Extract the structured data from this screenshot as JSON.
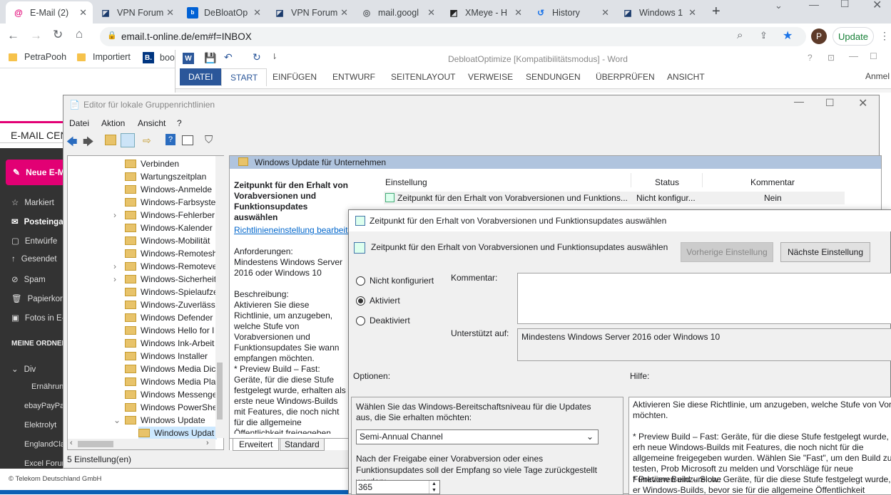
{
  "browser": {
    "tabs": [
      {
        "title": "E-Mail (2)",
        "icon": "email-icon"
      },
      {
        "title": "VPN Forum",
        "icon": "vpn-icon"
      },
      {
        "title": "DeBloatOp",
        "icon": "box-icon"
      },
      {
        "title": "VPN Forum",
        "icon": "vpn-icon"
      },
      {
        "title": "mail.googl",
        "icon": "globe-icon"
      },
      {
        "title": "XMeye - H",
        "icon": "xm-icon"
      },
      {
        "title": "History",
        "icon": "history-icon"
      },
      {
        "title": "Windows 1",
        "icon": "vpn-icon"
      }
    ],
    "url": "email.t-online.de/em#f=INBOX",
    "update_label": "Update",
    "profile_initial": "P",
    "bookmarks": [
      "PetraPooh",
      "Importiert",
      "boo"
    ]
  },
  "email": {
    "center_label": "E-MAIL CEN",
    "new_label": "Neue E-M",
    "nav": [
      "Markiert",
      "Posteinga",
      "Entwürfe",
      "Gesendet",
      "Spam",
      "Papierkorb",
      "Fotos in E-"
    ],
    "folders_heading": "MEINE ORDNER",
    "folders": [
      "Div",
      "Ernährun",
      "ebayPayPa",
      "Elektrolyt",
      "EnglandCla",
      "Excel Forun"
    ],
    "footer": "© Telekom Deutschland GmbH"
  },
  "word": {
    "title": "DebloatOptimize [Kompatibilitätsmodus] - Word",
    "tabs": [
      "DATEI",
      "START",
      "EINFÜGEN",
      "ENTWURF",
      "SEITENLAYOUT",
      "VERWEISE",
      "SENDUNGEN",
      "ÜBERPRÜFEN",
      "ANSICHT"
    ],
    "user": "Anmel"
  },
  "gpedit": {
    "title": "Editor für lokale Gruppenrichtlinien",
    "menu": [
      "Datei",
      "Aktion",
      "Ansicht",
      "?"
    ],
    "tree": [
      "Verbinden",
      "Wartungszeitplan",
      "Windows-Anmelde",
      "Windows-Farbsyste",
      "Windows-Fehlerber",
      "Windows-Kalender",
      "Windows-Mobilität",
      "Windows-Remotesh",
      "Windows-Remoteve",
      "Windows-Sicherheit",
      "Windows-Spielaufze",
      "Windows-Zuverläss",
      "Windows Defender",
      "Windows Hello for I",
      "Windows Ink-Arbeit",
      "Windows Installer",
      "Windows Media Dic",
      "Windows Media Pla",
      "Windows Messenge",
      "Windows PowerShe",
      "Windows Update",
      "Windows Updat"
    ],
    "header": "Windows Update für Unternehmen",
    "desc_title": "Zeitpunkt für den Erhalt von Vorabversionen und Funktionsupdates auswählen",
    "desc_link": "Richtlinieneinstellung bearbeiten",
    "req_label": "Anforderungen:",
    "req_text": "Mindestens Windows Server 2016 oder Windows 10",
    "descr_label": "Beschreibung:",
    "descr_text": "Aktivieren Sie diese Richtlinie, um anzugeben, welche Stufe von Vorabversionen und Funktionsupdates Sie wann empfangen möchten.",
    "descr_text2": "* Preview Build – Fast: Geräte, für die diese Stufe festgelegt wurde, erhalten als erste neue Windows-Builds mit Features, die noch nicht für die allgemeine Öffentlichkeit freigegeben wurden. Wählen Sie \"Fast\", um den Build zu test",
    "col_setting": "Einstellung",
    "col_status": "Status",
    "col_comment": "Kommentar",
    "row_setting": "Zeitpunkt für den Erhalt von Vorabversionen und Funktions...",
    "row_status": "Nicht konfigur...",
    "row_comment": "Nein",
    "tab_extended": "Erweitert",
    "tab_standard": "Standard",
    "status_bar": "5 Einstellung(en)"
  },
  "dialog": {
    "title": "Zeitpunkt für den Erhalt von Vorabversionen und Funktionsupdates auswählen",
    "heading": "Zeitpunkt für den Erhalt von Vorabversionen und Funktionsupdates auswählen",
    "prev_button": "Vorherige Einstellung",
    "next_button": "Nächste Einstellung",
    "opt_not_configured": "Nicht konfiguriert",
    "opt_enabled": "Aktiviert",
    "opt_disabled": "Deaktiviert",
    "comment_label": "Kommentar:",
    "supported_label": "Unterstützt auf:",
    "supported_text": "Mindestens Windows Server 2016 oder Windows 10",
    "options_label": "Optionen:",
    "help_label": "Hilfe:",
    "readiness_label": "Wählen Sie das Windows-Bereitschaftsniveau für die Updates aus, die Sie erhalten möchten:",
    "readiness_value": "Semi-Annual Channel",
    "defer_label": "Nach der Freigabe einer Vorabversion oder eines Funktionsupdates soll der Empfang so viele Tage zurückgestellt werden:",
    "defer_value": "365",
    "help_p1": "Aktivieren Sie diese Richtlinie, um anzugeben, welche Stufe von Vorab Funktionsupdates Sie wann empfangen möchten.",
    "help_p2": "* Preview Build – Fast: Geräte, für die diese Stufe festgelegt wurde, erh neue Windows-Builds mit Features, die noch nicht für die allgemeine freigegeben wurden. Wählen Sie \"Fast\", um den Build zu testen, Prob Microsoft zu melden und Vorschläge für neue Funktionen einzureiche",
    "help_p3": "* Preview Build – Slow: Geräte, für die diese Stufe festgelegt wurde, er Windows-Builds, bevor sie für die allgemeine Öffentlichkeit freigegeb"
  },
  "colors": {
    "accent_pink": "#e20074",
    "selection": "#cce8ff",
    "word_blue": "#2b579a"
  }
}
